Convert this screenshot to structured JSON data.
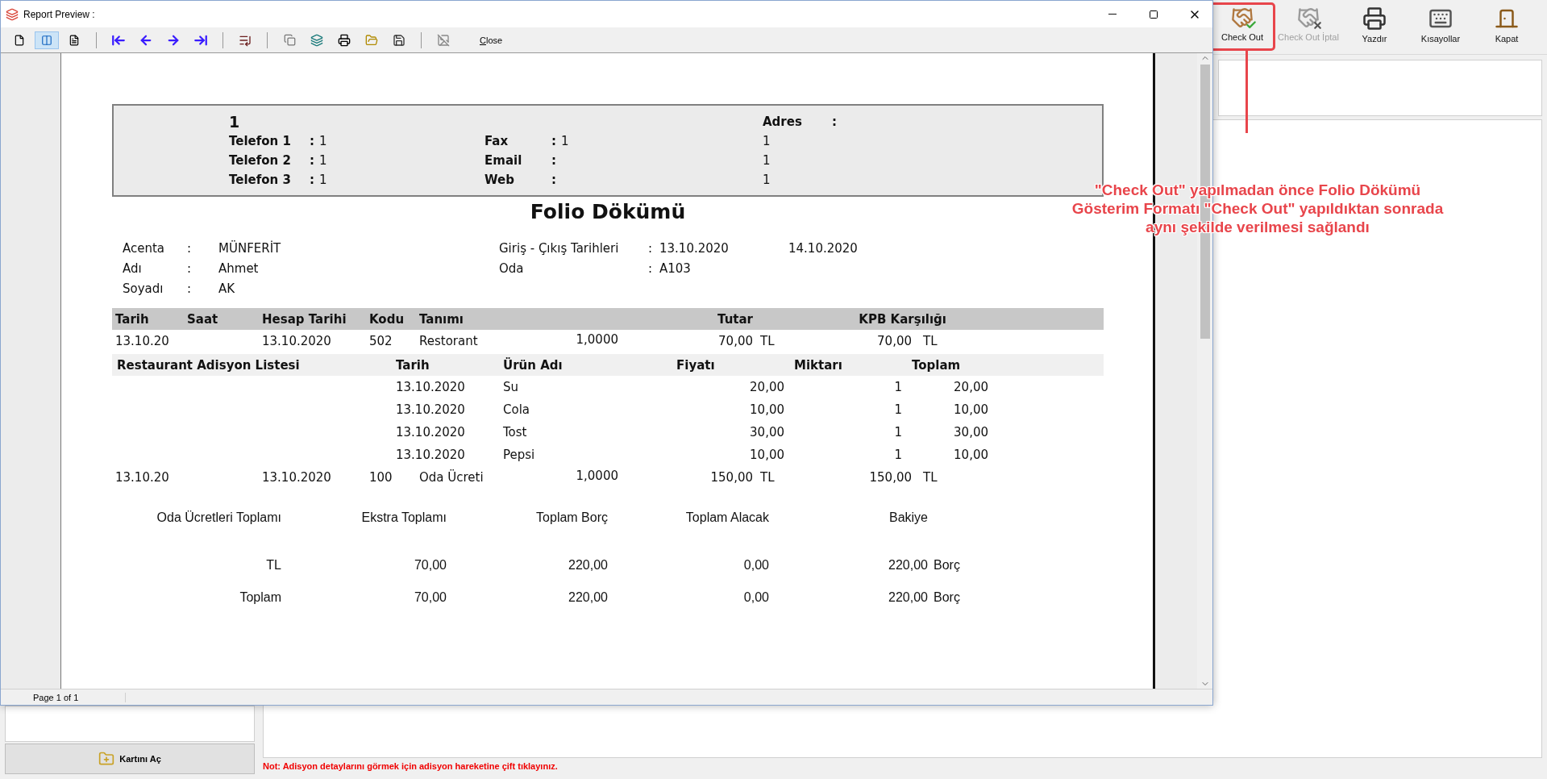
{
  "app": {
    "toolbar": [
      {
        "kind": "checkout",
        "label": "Check Out",
        "disabled": false,
        "highlighted": true
      },
      {
        "kind": "cancel",
        "label": "Check Out İptal",
        "disabled": true,
        "highlighted": false
      },
      {
        "kind": "print",
        "label": "Yazdır",
        "disabled": false,
        "highlighted": false
      },
      {
        "kind": "shortcuts",
        "label": "Kısayollar",
        "disabled": false,
        "highlighted": false
      },
      {
        "kind": "exit",
        "label": "Kapat",
        "disabled": false,
        "highlighted": false
      }
    ],
    "open_card_button": "Kartını Aç",
    "note": "Not: Adisyon detaylarını görmek için adisyon hareketine çift tıklayınız.",
    "annotation": {
      "lines": [
        "\"Check Out\" yapılmadan önce Folio Dökümü",
        "Gösterim Formatı \"Check Out\" yapıldıktan sonrada",
        "aynı şekilde verilmesi sağlandı"
      ]
    }
  },
  "preview_window": {
    "title": "Report Preview :",
    "view_modes": [
      {
        "selected": false
      },
      {
        "selected": true
      },
      {
        "selected": false
      }
    ],
    "close_label": "Close",
    "status": "Page 1 of 1"
  },
  "report": {
    "company": {
      "name": "1",
      "address_label": "Adres",
      "address_sep": ":",
      "phones": [
        {
          "label": "Telefon 1",
          "sep": ":",
          "value": "1"
        },
        {
          "label": "Telefon 2",
          "sep": ":",
          "value": "1"
        },
        {
          "label": "Telefon 3",
          "sep": ":",
          "value": "1"
        }
      ],
      "contacts": [
        {
          "label": "Fax",
          "sep": ":",
          "value": "1"
        },
        {
          "label": "Email",
          "sep": ":"
        },
        {
          "label": "Web",
          "sep": ":"
        }
      ],
      "address_lines": [
        "1",
        "1",
        "1"
      ]
    },
    "title": "Folio Dökümü",
    "guest": [
      {
        "label": "Acenta",
        "sep": ":",
        "value": "MÜNFERİT"
      },
      {
        "label": "Adı",
        "sep": ":",
        "value": "Ahmet"
      },
      {
        "label": "Soyadı",
        "sep": ":",
        "value": "AK"
      }
    ],
    "stay": [
      {
        "label": "Giriş - Çıkış Tarihleri",
        "sep": ":",
        "value": "13.10.2020",
        "value2": "14.10.2020"
      },
      {
        "label": "Oda",
        "sep": ":",
        "value": "A103"
      }
    ],
    "columns": [
      "Tarih",
      "Saat",
      "Hesap Tarihi",
      "Kodu",
      "Tanımı",
      "Tutar",
      "KPB Karşılığı"
    ],
    "rows": [
      {
        "kind": "charge",
        "date": "13.10.20",
        "account_date": "13.10.2020",
        "code": "502",
        "desc": "Restorant",
        "qty": "1,0000",
        "amount": "70,00",
        "currency": "TL",
        "kpb": "70,00",
        "kpb_currency": "TL"
      },
      {
        "kind": "checks",
        "title": "Restaurant Adisyon Listesi",
        "columns": [
          "Tarih",
          "Ürün Adı",
          "Fiyatı",
          "Miktarı",
          "Toplam"
        ],
        "items": [
          {
            "date": "13.10.2020",
            "product": "Su",
            "price": "20,00",
            "qty": "1",
            "total": "20,00"
          },
          {
            "date": "13.10.2020",
            "product": "Cola",
            "price": "10,00",
            "qty": "1",
            "total": "10,00"
          },
          {
            "date": "13.10.2020",
            "product": "Tost",
            "price": "30,00",
            "qty": "1",
            "total": "30,00"
          },
          {
            "date": "13.10.2020",
            "product": "Pepsi",
            "price": "10,00",
            "qty": "1",
            "total": "10,00"
          }
        ]
      },
      {
        "kind": "charge",
        "date": "13.10.20",
        "account_date": "13.10.2020",
        "code": "100",
        "desc": "Oda Ücreti",
        "qty": "1,0000",
        "amount": "150,00",
        "currency": "TL",
        "kpb": "150,00",
        "kpb_currency": "TL"
      }
    ],
    "summary": {
      "columns": [
        "Oda Ücretleri Toplamı",
        "Ekstra Toplamı",
        "Toplam Borç",
        "Toplam Alacak",
        "Bakiye"
      ],
      "rows": [
        {
          "label": "TL",
          "values": [
            "70,00",
            "220,00",
            "0,00",
            "220,00"
          ],
          "balance_type": "Borç"
        },
        {
          "label": "Toplam",
          "values": [
            "70,00",
            "220,00",
            "0,00",
            "220,00"
          ],
          "balance_type": "Borç"
        }
      ]
    }
  }
}
